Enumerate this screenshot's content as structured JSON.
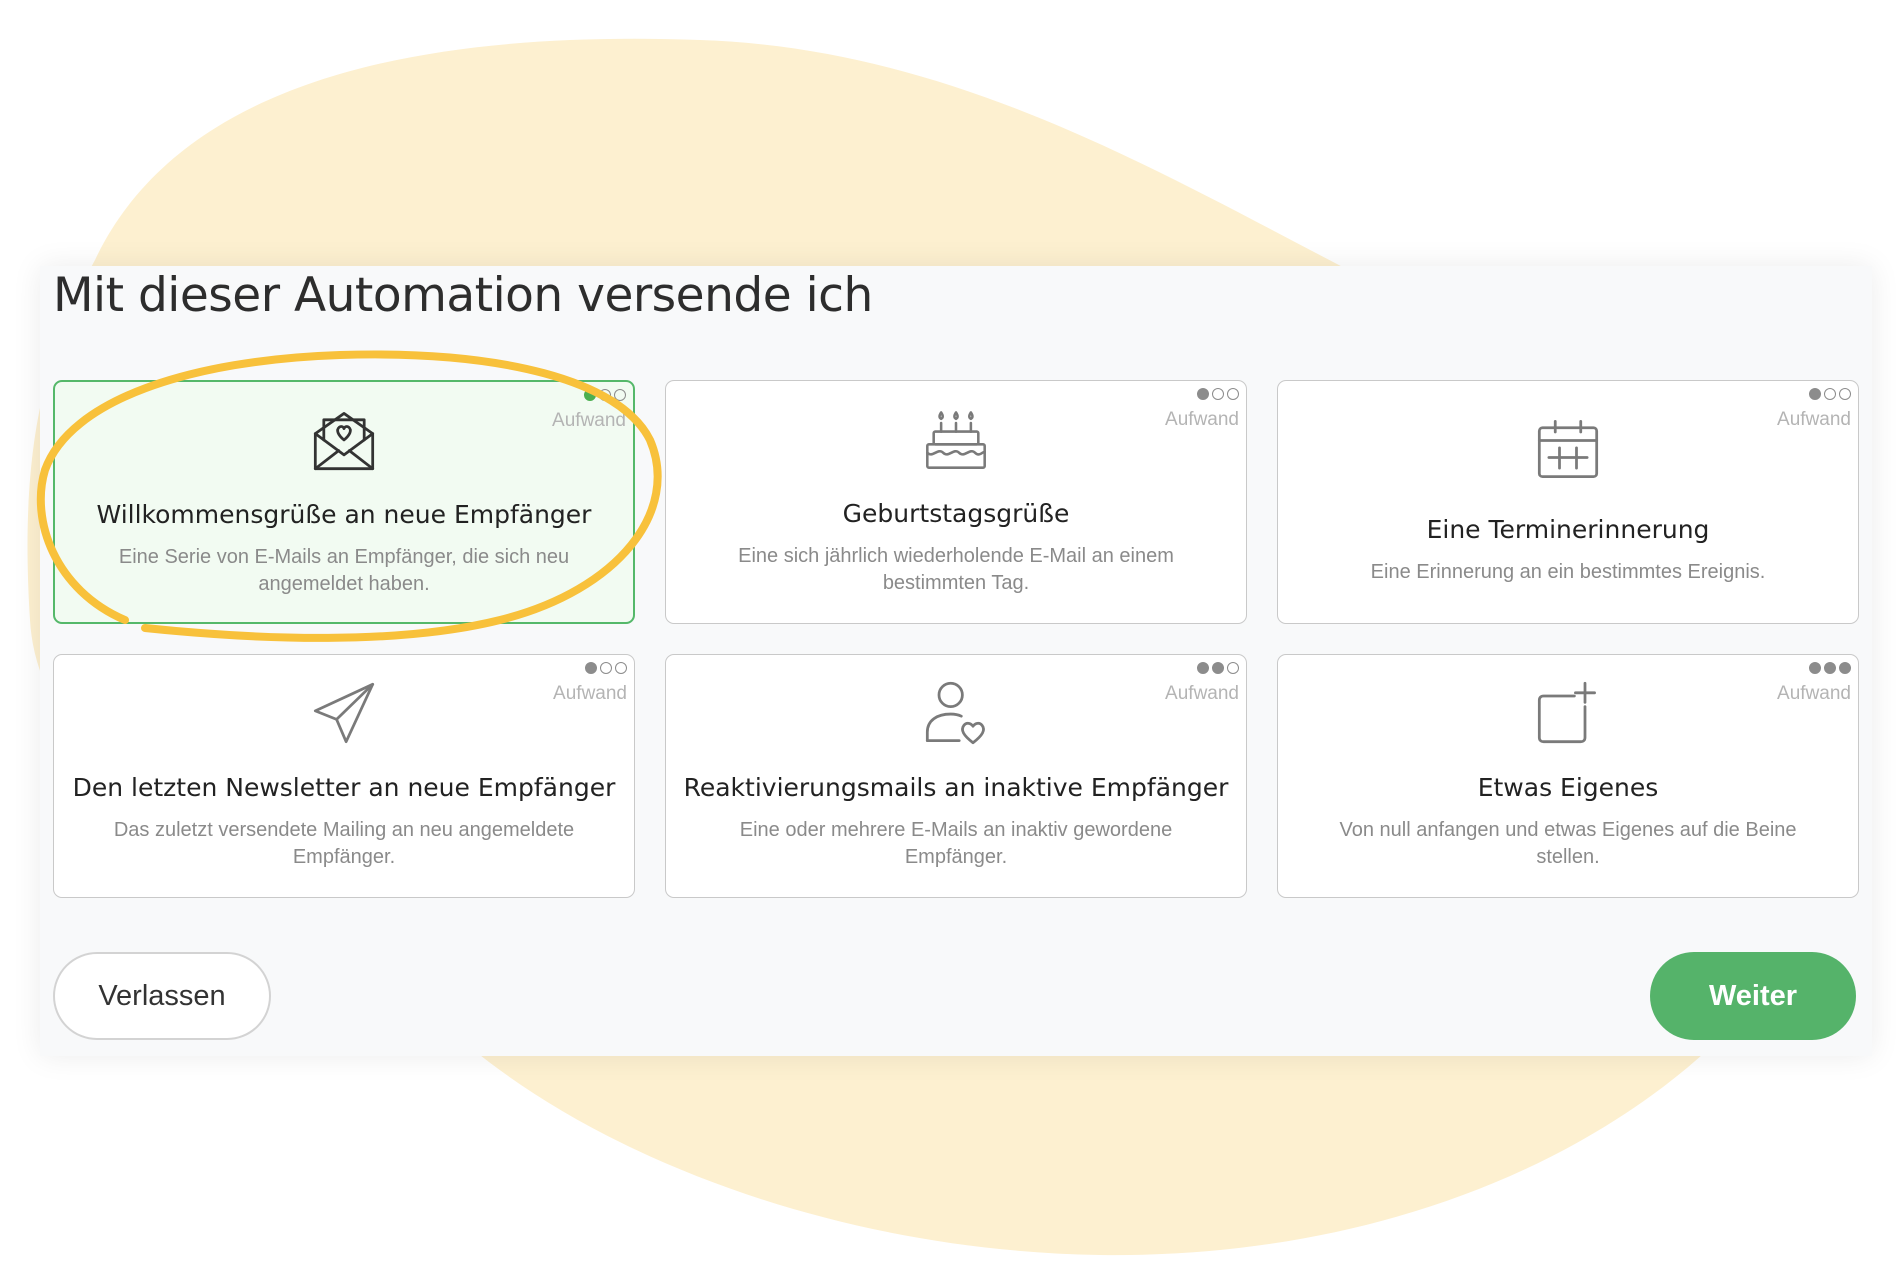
{
  "page": {
    "title": "Mit dieser Automation versende ich",
    "effort_label": "Aufwand"
  },
  "colors": {
    "accent_green": "#55b36a",
    "highlight_yellow": "#f8c13b",
    "blob_cream": "#fdf0d0",
    "panel_background": "#f8f9fa"
  },
  "cards": [
    {
      "title": "Willkommensgrüße an neue Empfänger",
      "description": "Eine Serie von E-Mails an Empfänger, die sich neu angemeldet haben.",
      "icon": "envelope-heart-icon",
      "effort": 1,
      "selected": true
    },
    {
      "title": "Geburtstagsgrüße",
      "description": "Eine sich jährlich wiederholende E-Mail an einem bestimmten Tag.",
      "icon": "birthday-cake-icon",
      "effort": 1,
      "selected": false
    },
    {
      "title": "Eine Terminerinnerung",
      "description": "Eine Erinnerung an ein bestimmtes Ereignis.",
      "icon": "calendar-icon",
      "effort": 1,
      "selected": false
    },
    {
      "title": "Den letzten Newsletter an neue Empfänger",
      "description": "Das zuletzt versendete Mailing an neu angemeldete Empfänger.",
      "icon": "paper-plane-icon",
      "effort": 1,
      "selected": false
    },
    {
      "title": "Reaktivierungsmails an inaktive Empfänger",
      "description": "Eine oder mehrere E-Mails an inaktiv gewordene Empfänger.",
      "icon": "user-heart-icon",
      "effort": 2,
      "selected": false
    },
    {
      "title": "Etwas Eigenes",
      "description": "Von null anfangen und etwas Eigenes auf die Beine stellen.",
      "icon": "square-plus-icon",
      "effort": 3,
      "selected": false
    }
  ],
  "buttons": {
    "leave_label": "Verlassen",
    "next_label": "Weiter"
  }
}
